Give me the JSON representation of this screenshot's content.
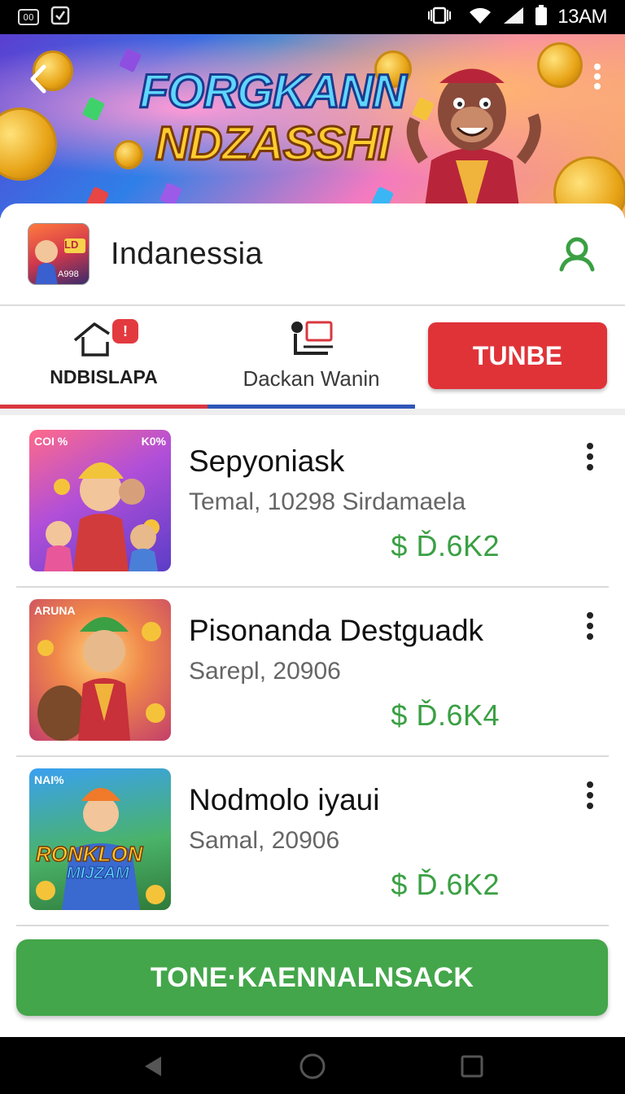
{
  "status_bar": {
    "time": "13AM",
    "icon_text_1": "OO"
  },
  "banner": {
    "title_line_1": "FORGKANN",
    "title_line_2": "NDZASSHI"
  },
  "app": {
    "name": "Indanessia",
    "icon_badge": "LD",
    "icon_small_text": "A998"
  },
  "tabs": [
    {
      "label": "NDBISLAPA",
      "badge": "!"
    },
    {
      "label": "Dackan Wanin"
    }
  ],
  "tunbe_button": {
    "label": "TUNBE"
  },
  "items": [
    {
      "title": "Sepyoniask",
      "subtitle": "Temal, 10298 Sirdamaela",
      "price": "$ Ď.6K2",
      "tag_left": "COI %",
      "tag_right": "K0%"
    },
    {
      "title": "Pisonanda Destguadk",
      "subtitle": "Sarepl, 20906",
      "price": "$ Ď.6K4",
      "tag_left": "ARUNA"
    },
    {
      "title": "Nodmolo iyaui",
      "subtitle": "Samal, 20906",
      "price": "$ Ď.6K2",
      "tag_left": "NAI%",
      "thumb_text_1": "RONKLON",
      "thumb_text_2": "MIJZAM"
    }
  ],
  "cta_button": {
    "label": "TONE·KAENNALNSACK"
  },
  "colors": {
    "accent_red": "#e03338",
    "accent_green": "#43a64a",
    "price_green": "#3aa043",
    "tab_blue": "#2f56b8"
  }
}
